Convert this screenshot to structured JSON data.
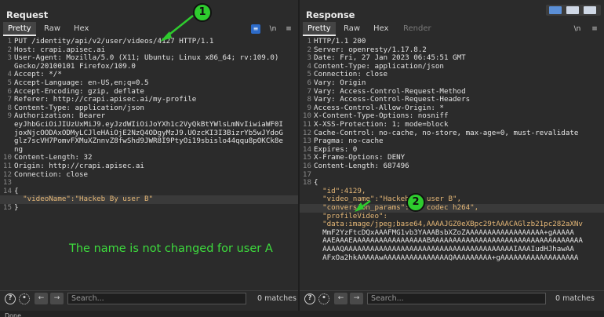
{
  "request": {
    "title": "Request",
    "tabs": [
      "Pretty",
      "Raw",
      "Hex"
    ],
    "lines": [
      "PUT /identity/api/v2/user/videos/4127 HTTP/1.1",
      "Host: crapi.apisec.ai",
      "User-Agent: Mozilla/5.0 (X11; Ubuntu; Linux x86_64; rv:109.0)",
      "Gecko/20100101 Firefox/109.0",
      "Accept: */*",
      "Accept-Language: en-US,en;q=0.5",
      "Accept-Encoding: gzip, deflate",
      "Referer: http://crapi.apisec.ai/my-profile",
      "Content-Type: application/json",
      "Authorization: Bearer",
      "eyJhbGciOiJIUzUxMiJ9.eyJzdWIiOiJoYXh1c2VyQkBtYWlsLmNvIiwiaWF0I",
      "joxNjcOODAxODMyLCJleHAiOjE2NzQ4ODgyMzJ9.UOzcKI3I3BizrYb5wJYdoG",
      "glz7scVH7PomvFXMuXZnnvZ8fwShd9JWR8I9PtyOi19sbislo44qqu8pOKCk8e",
      "ng",
      "Content-Length: 32",
      "Origin: http://crapi.apisec.ai",
      "Connection: close",
      "",
      "{",
      "  \"videoName\":\"Hackeb By user B\"",
      "}"
    ],
    "line_numbers": [
      "1",
      "2",
      "3",
      "",
      "4",
      "5",
      "6",
      "7",
      "8",
      "9",
      "",
      "",
      "",
      "",
      "10",
      "11",
      "12",
      "13",
      "14",
      "",
      "15"
    ],
    "search_placeholder": "Search...",
    "matches": "0 matches"
  },
  "response": {
    "title": "Response",
    "tabs": [
      "Pretty",
      "Raw",
      "Hex",
      "Render"
    ],
    "lines": [
      "HTTP/1.1 200",
      "Server: openresty/1.17.8.2",
      "Date: Fri, 27 Jan 2023 06:45:51 GMT",
      "Content-Type: application/json",
      "Connection: close",
      "Vary: Origin",
      "Vary: Access-Control-Request-Method",
      "Vary: Access-Control-Request-Headers",
      "Access-Control-Allow-Origin: *",
      "X-Content-Type-Options: nosniff",
      "X-XSS-Protection: 1; mode=block",
      "Cache-Control: no-cache, no-store, max-age=0, must-revalidate",
      "Pragma: no-cache",
      "Expires: 0",
      "X-Frame-Options: DENY",
      "Content-Length: 687496",
      "",
      "{",
      "  \"id\":4129,",
      "  \"video_name\":\"Hackeb By user B\",",
      "  \"conversion_params\":\"-v codec h264\",",
      "  \"profileVideo\":",
      "  \"data:image/jpeg;base64,AAAAJGZ0eXBpc29tAAACAGlzb21pc282aXNv",
      "  MmF2YzFtcDQxAAAFMG1vb3YAAABsbXZoZAAAAAAAAAAAAAAAAAA+gAAAAA",
      "  AAEAAAEAAAAAAAAAAAAAAAAABAAAAAAAAAAAAAAAAAAAAAAAAAAAAAAAAAAA",
      "  AAAAQAAAAAAAAAAAAAAAAAAAAAAAAAAAAAAAAAAAAAAAIAAAIudHJhawAA",
      "  AFxOa2hkAAAAAwAAAAAAAAAAAAAAAQAAAAAAAAA+gAAAAAAAAAAAAAAAAAA"
    ],
    "line_numbers": [
      "1",
      "2",
      "3",
      "4",
      "5",
      "6",
      "7",
      "8",
      "9",
      "10",
      "11",
      "12",
      "13",
      "14",
      "15",
      "16",
      "17",
      "18",
      "",
      "",
      "",
      "",
      "",
      "",
      "",
      "",
      ""
    ],
    "search_placeholder": "Search...",
    "matches": "0 matches"
  },
  "annotation": {
    "marker_1": "1",
    "marker_2": "2",
    "note": "The name is not changed for user A"
  },
  "status": "Done"
}
